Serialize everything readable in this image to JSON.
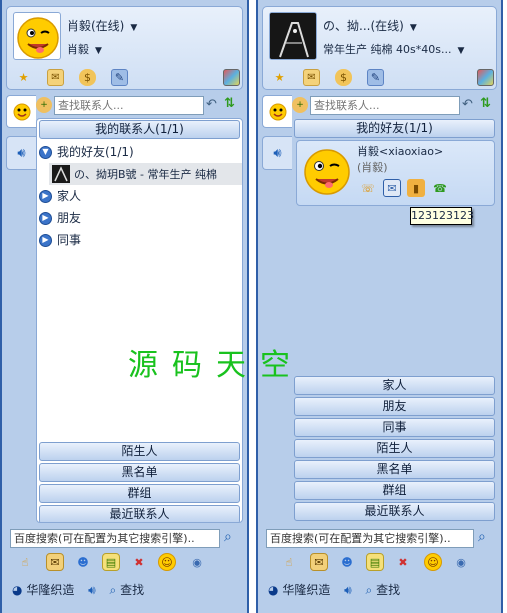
{
  "left": {
    "user_name": "肖毅(在线)",
    "signature": "肖毅",
    "search_placeholder": "查找联系人...",
    "contacts_header": "我的联系人(1/1)",
    "group_friends": "我的好友(1/1)",
    "friend_entry": "の、拗玥B號 - 常年生产 纯棉",
    "groups": [
      "家人",
      "朋友",
      "同事"
    ],
    "bottom_groups": [
      "陌生人",
      "黑名单",
      "群组",
      "最近联系人"
    ],
    "baidu_search": "百度搜索(可在配置为其它搜索引擎)..",
    "footer_brand": "华隆织造",
    "footer_search": "查找"
  },
  "right": {
    "user_name": "の、拗...(在线)",
    "signature": "常年生产 纯棉 40s*40s...",
    "search_placeholder": "查找联系人...",
    "friends_header": "我的好友(1/1)",
    "card_name": "肖毅<xiaoxiao>",
    "card_nick": "(肖毅)",
    "tooltip": "123123123",
    "groups": [
      "家人",
      "朋友",
      "同事",
      "陌生人",
      "黑名单",
      "群组",
      "最近联系人"
    ],
    "baidu_search": "百度搜索(可在配置为其它搜索引擎)..",
    "footer_brand": "华隆织造",
    "footer_search": "查找"
  },
  "watermark": "源码天空",
  "icons": {
    "profile_toolbar": [
      "star-icon",
      "mail-icon",
      "money-icon",
      "settings-icon",
      "skin-icon"
    ],
    "bottom_toolbar": [
      "hand-icon",
      "chat-icon",
      "users-icon",
      "file-icon",
      "block-icon",
      "smile-icon",
      "webcam-icon",
      "search-icon"
    ]
  },
  "colors": {
    "panel_bg": "#b7cdea",
    "border": "#2f5fa8",
    "watermark": "#19c21e"
  }
}
